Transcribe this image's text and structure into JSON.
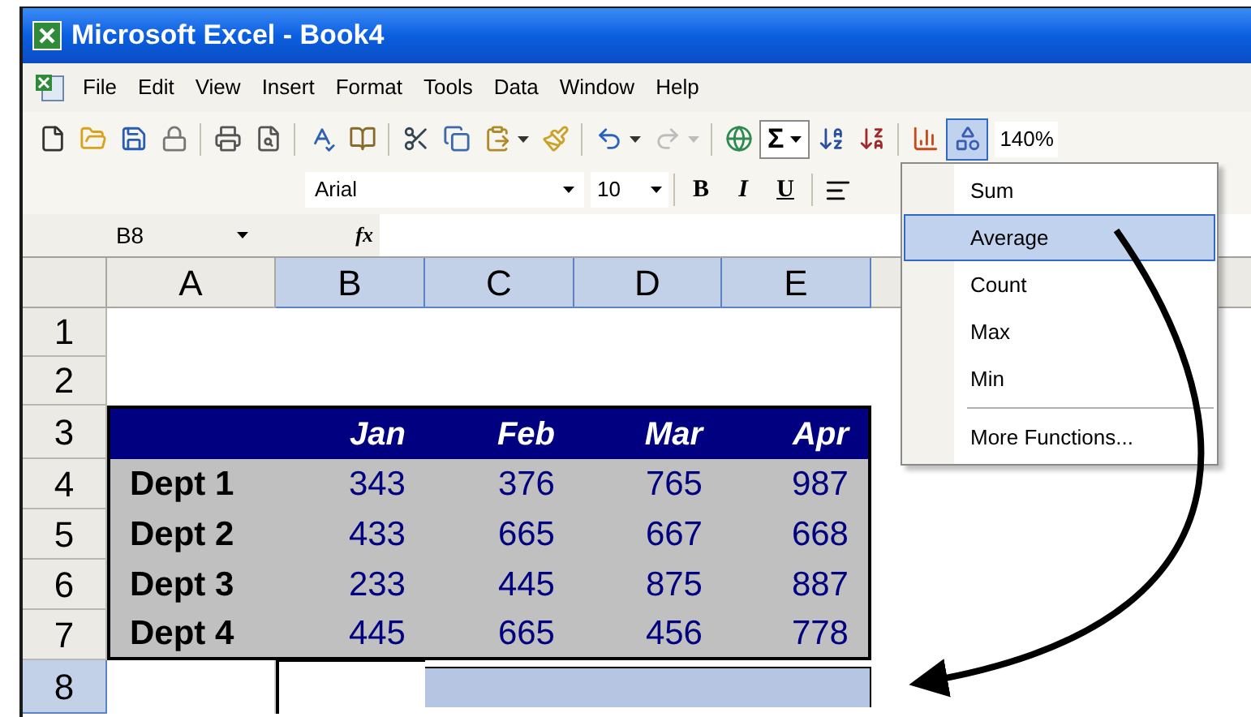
{
  "window": {
    "title": "Microsoft Excel - Book4"
  },
  "menu_bar": [
    "File",
    "Edit",
    "View",
    "Insert",
    "Format",
    "Tools",
    "Data",
    "Window",
    "Help"
  ],
  "standard_toolbar": {
    "redo": {
      "disabled": true
    },
    "autosum": {
      "symbol": "Σ",
      "pressed": true
    },
    "drawing": {
      "pressed": true
    },
    "zoom": "140%"
  },
  "formatting_toolbar": {
    "font": "Arial",
    "size": "10",
    "buttons": [
      {
        "label": "B",
        "kind": "bold"
      },
      {
        "label": "I",
        "kind": "italic"
      },
      {
        "label": "U",
        "kind": "underline"
      }
    ]
  },
  "formula_bar": {
    "name_box": "B8",
    "function_symbol": "fx"
  },
  "columns": [
    {
      "label": "A",
      "selected": false
    },
    {
      "label": "B",
      "selected": true
    },
    {
      "label": "C",
      "selected": true
    },
    {
      "label": "D",
      "selected": true
    },
    {
      "label": "E",
      "selected": true
    }
  ],
  "rows": [
    {
      "label": "1",
      "selected": false,
      "kind": "blank"
    },
    {
      "label": "2",
      "selected": false,
      "kind": "blank"
    },
    {
      "label": "3",
      "selected": false,
      "kind": "header",
      "cells": [
        "Jan",
        "Feb",
        "Mar",
        "Apr"
      ]
    },
    {
      "label": "4",
      "selected": false,
      "kind": "data",
      "name": "Dept 1",
      "cells": [
        "343",
        "376",
        "765",
        "987"
      ]
    },
    {
      "label": "5",
      "selected": false,
      "kind": "data",
      "name": "Dept 2",
      "cells": [
        "433",
        "665",
        "667",
        "668"
      ]
    },
    {
      "label": "6",
      "selected": false,
      "kind": "data",
      "name": "Dept 3",
      "cells": [
        "233",
        "445",
        "875",
        "887"
      ]
    },
    {
      "label": "7",
      "selected": false,
      "kind": "data",
      "name": "Dept 4",
      "cells": [
        "445",
        "665",
        "456",
        "778"
      ]
    },
    {
      "label": "8",
      "selected": true,
      "kind": "selection",
      "selection": [
        {
          "selected": false
        },
        {
          "selected": false
        },
        {
          "selected": true
        },
        {
          "selected": true
        },
        {
          "selected": true
        }
      ]
    }
  ],
  "autosum_menu": [
    {
      "label": "Sum",
      "selected": false,
      "kind": "item"
    },
    {
      "label": "Average",
      "selected": true,
      "kind": "item"
    },
    {
      "label": "Count",
      "selected": false,
      "kind": "item"
    },
    {
      "label": "Max",
      "selected": false,
      "kind": "item"
    },
    {
      "label": "Min",
      "selected": false,
      "kind": "item"
    },
    {
      "label": "More Functions...",
      "selected": false,
      "kind": "separated"
    }
  ]
}
